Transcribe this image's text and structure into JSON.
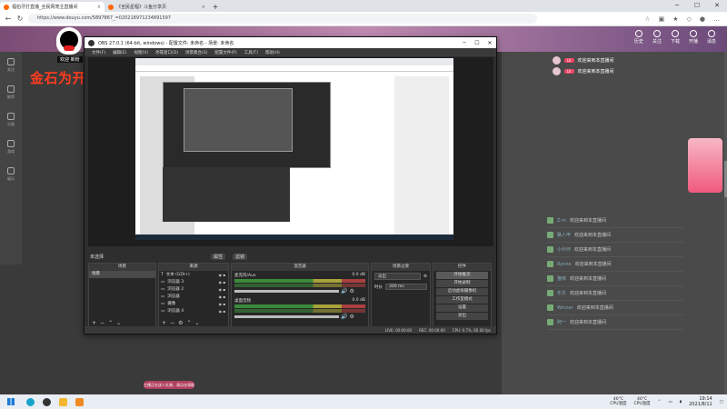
{
  "browser": {
    "tabs": [
      {
        "title": "福伯牙打直播_全民网宠主直播间",
        "active": true
      },
      {
        "title": "《全民星程》斗鱼分享页",
        "active": false
      }
    ],
    "url": "https://www.douyu.com/5897867_=020218971234891597"
  },
  "site": {
    "header_icons": [
      "历史",
      "关注",
      "下载",
      "开播",
      "消息"
    ],
    "sidebar": [
      "关注",
      "推荐",
      "分类",
      "游戏",
      "娱乐"
    ],
    "overlay_label": "欢迎 新粉",
    "overlay_title": "金石为开86694",
    "chat_top": [
      "欢迎来到本直播间",
      "欢迎来到本直播间"
    ],
    "chat_rows": [
      {
        "name": "Z-m",
        "msg": "欢迎来到本直播间"
      },
      {
        "name": "路人甲",
        "msg": "欢迎来到本直播间"
      },
      {
        "name": "小伙伴",
        "msg": "欢迎来到本直播间"
      },
      {
        "name": "Rynne",
        "msg": "欢迎来到本直播间"
      },
      {
        "name": "猫咪",
        "msg": "欢迎来到本直播间"
      },
      {
        "name": "乐乐",
        "msg": "欢迎来到本直播间"
      },
      {
        "name": "Winner",
        "msg": "欢迎来到本直播间"
      },
      {
        "name": "阿一",
        "msg": "欢迎来到本直播间"
      }
    ],
    "ad_chip": "主播正在送人礼物，请点击领取"
  },
  "obs": {
    "title": "OBS 27.0.1 (64-bit, windows) - 配置文件: 未命名 - 场景: 未命名",
    "menu": [
      "文件(F)",
      "编辑(E)",
      "视图(V)",
      "停靠窗口(D)",
      "场景集合(S)",
      "配置文件(P)",
      "工具(T)",
      "帮助(H)"
    ],
    "toolbar": {
      "label": "未选择",
      "props": "属性",
      "filters": "滤镜"
    },
    "docks": {
      "scenes": {
        "title": "场景",
        "items": [
          "场景"
        ]
      },
      "sources": {
        "title": "来源",
        "items": [
          "文本 (GDI+)",
          "浏览器 3",
          "浏览器 2",
          "浏览器",
          "摄像",
          "浏览器 4"
        ]
      },
      "mixer": {
        "title": "混音器",
        "channels": [
          {
            "name": "麦克风/Aux",
            "db": "0.0 dB"
          },
          {
            "name": "桌面音频",
            "db": "0.0 dB"
          }
        ]
      },
      "transitions": {
        "title": "场景过渡",
        "type": "淡出",
        "duration_label": "时长",
        "duration": "300 ms"
      },
      "controls": {
        "title": "控件",
        "buttons": [
          "开始推流",
          "开始录制",
          "启动虚拟摄像机",
          "工作室模式",
          "设置",
          "退出"
        ]
      }
    },
    "status": [
      "LIVE: 00:00:00",
      "REC: 00:00:00",
      "CPU: 0.7%, 60.00 fps"
    ]
  },
  "taskbar": {
    "weather1": {
      "temp": "40°C",
      "label": "CPU温度"
    },
    "weather2": {
      "temp": "40°C",
      "label": "CPU温度"
    },
    "time": "19:14",
    "date": "2021/8/11"
  }
}
